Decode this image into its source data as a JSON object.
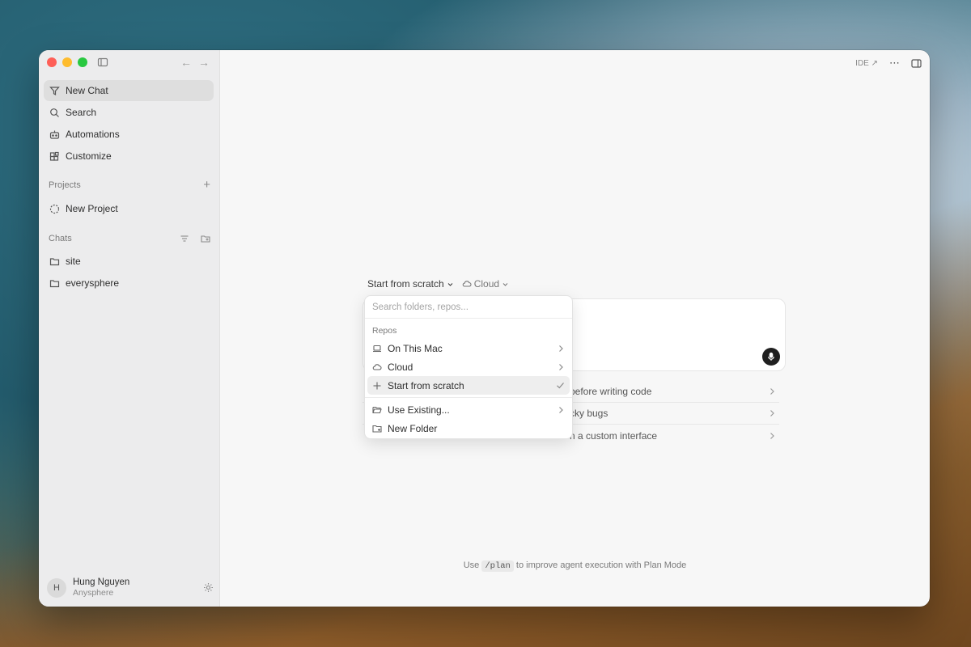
{
  "sidebar": {
    "nav": [
      {
        "label": "New Chat",
        "icon": "new-chat-icon",
        "active": true
      },
      {
        "label": "Search",
        "icon": "search-icon"
      },
      {
        "label": "Automations",
        "icon": "robot-icon"
      },
      {
        "label": "Customize",
        "icon": "blocks-icon"
      }
    ],
    "projects_label": "Projects",
    "projects": [
      {
        "label": "New Project",
        "icon": "dashed-circle-icon"
      }
    ],
    "chats_label": "Chats",
    "chats": [
      {
        "label": "site",
        "icon": "folder-icon"
      },
      {
        "label": "everysphere",
        "icon": "folder-icon"
      }
    ],
    "user": {
      "initial": "H",
      "name": "Hung Nguyen",
      "org": "Anysphere"
    }
  },
  "topbar": {
    "ide_label": "IDE ↗"
  },
  "selectors": {
    "workspace": "Start from scratch",
    "environment": "Cloud"
  },
  "dropdown": {
    "search_placeholder": "Search folders, repos...",
    "repos_label": "Repos",
    "items": [
      {
        "label": "On This Mac",
        "icon": "laptop-icon"
      },
      {
        "label": "Cloud",
        "icon": "cloud-icon"
      },
      {
        "label": "Start from scratch",
        "icon": "plus-icon",
        "selected": true
      }
    ],
    "items2": [
      {
        "label": "Use Existing...",
        "icon": "folder-open-icon"
      },
      {
        "label": "New Folder",
        "icon": "folder-plus-icon"
      }
    ]
  },
  "suggestions": [
    {
      "visible_text": "before writing code"
    },
    {
      "visible_text": "cky bugs"
    },
    {
      "visible_text": "n a custom interface"
    }
  ],
  "tip": {
    "prefix": "Use",
    "command": "/plan",
    "suffix": "to improve agent execution with Plan Mode"
  }
}
